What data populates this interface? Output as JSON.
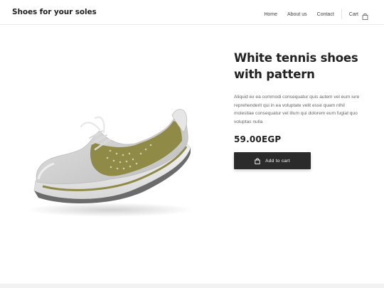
{
  "header": {
    "brand": "Shoes for your soles",
    "nav": [
      {
        "label": "Home"
      },
      {
        "label": "About us"
      },
      {
        "label": "Contact"
      }
    ],
    "cart_label": "Cart",
    "cart_icon": "shopping-bag-icon"
  },
  "product": {
    "image_icon": "sneaker-icon",
    "title_line1": "White tennis shoes",
    "title_line2": "with pattern",
    "description": "Aliquid ex ea commodi consequatur quis autem vel eum iure reprehenderit qui in ea voluptate velit esse quam nihil molestiae consequatur vel illum qui dolorem eum fugiat quo voluptas nulla",
    "price": "59.00EGP",
    "add_to_cart_label": "Add to cart",
    "add_to_cart_icon": "shopping-bag-icon"
  },
  "colors": {
    "accent_button": "#2b2b2b",
    "shoe_olive": "#8f8a45",
    "shoe_grey": "#c9c9c9"
  }
}
